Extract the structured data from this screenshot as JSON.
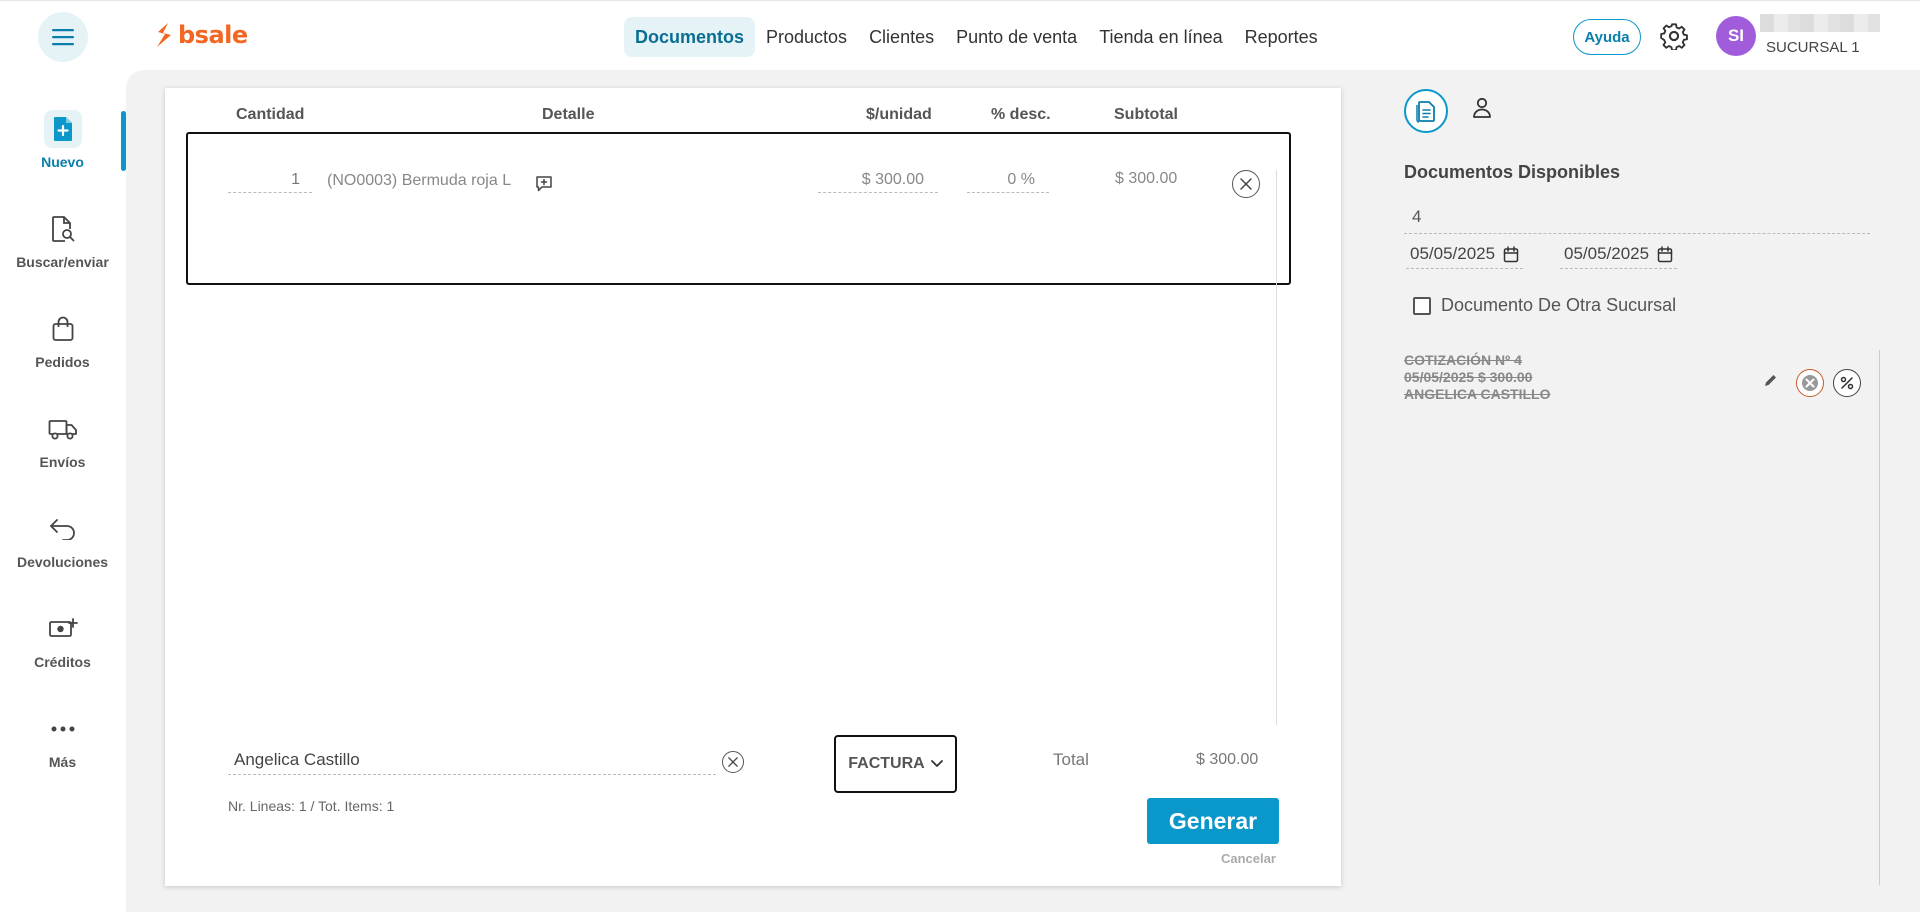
{
  "header": {
    "logo": "bsale",
    "nav": [
      {
        "label": "Documentos"
      },
      {
        "label": "Productos"
      },
      {
        "label": "Clientes"
      },
      {
        "label": "Punto de venta"
      },
      {
        "label": "Tienda en línea"
      },
      {
        "label": "Reportes"
      }
    ],
    "help": "Ayuda",
    "avatar_initials": "SI",
    "branch": "SUCURSAL 1"
  },
  "sidebar": {
    "items": [
      {
        "label": "Nuevo",
        "icon": "new-document-icon"
      },
      {
        "label": "Buscar/enviar",
        "icon": "search-document-icon"
      },
      {
        "label": "Pedidos",
        "icon": "bag-icon"
      },
      {
        "label": "Envíos",
        "icon": "truck-icon"
      },
      {
        "label": "Devoluciones",
        "icon": "return-icon"
      },
      {
        "label": "Créditos",
        "icon": "money-plus-icon"
      },
      {
        "label": "Más",
        "icon": "more-dots-icon"
      }
    ]
  },
  "document": {
    "columns": {
      "cantidad": "Cantidad",
      "detalle": "Detalle",
      "unit_price": "$/unidad",
      "discount": "% desc.",
      "subtotal": "Subtotal"
    },
    "line": {
      "quantity": "1",
      "detail": "(NO0003) Bermuda roja L",
      "unit_price": "$ 300.00",
      "discount": "0 %",
      "subtotal": "$ 300.00"
    },
    "customer": "Angelica Castillo",
    "doc_type": "FACTURA",
    "total_label": "Total",
    "total_value": "$ 300.00",
    "lines_info": "Nr. Lineas: 1 / Tot. Items: 1",
    "generate": "Generar",
    "cancel": "Cancelar"
  },
  "right_panel": {
    "title": "Documentos Disponibles",
    "number": "4",
    "date_from": "05/05/2025",
    "date_to": "05/05/2025",
    "other_branch_label": "Documento De Otra Sucursal",
    "other_branch_checked": false,
    "quote": {
      "title": "COTIZACIÓN Nº 4",
      "date_amount": "05/05/2025 $ 300.00",
      "client": "ANGELICA CASTILLO"
    }
  },
  "colors": {
    "brand": "#f26722",
    "accent": "#0a97c9",
    "avatar": "#a05cdb"
  }
}
